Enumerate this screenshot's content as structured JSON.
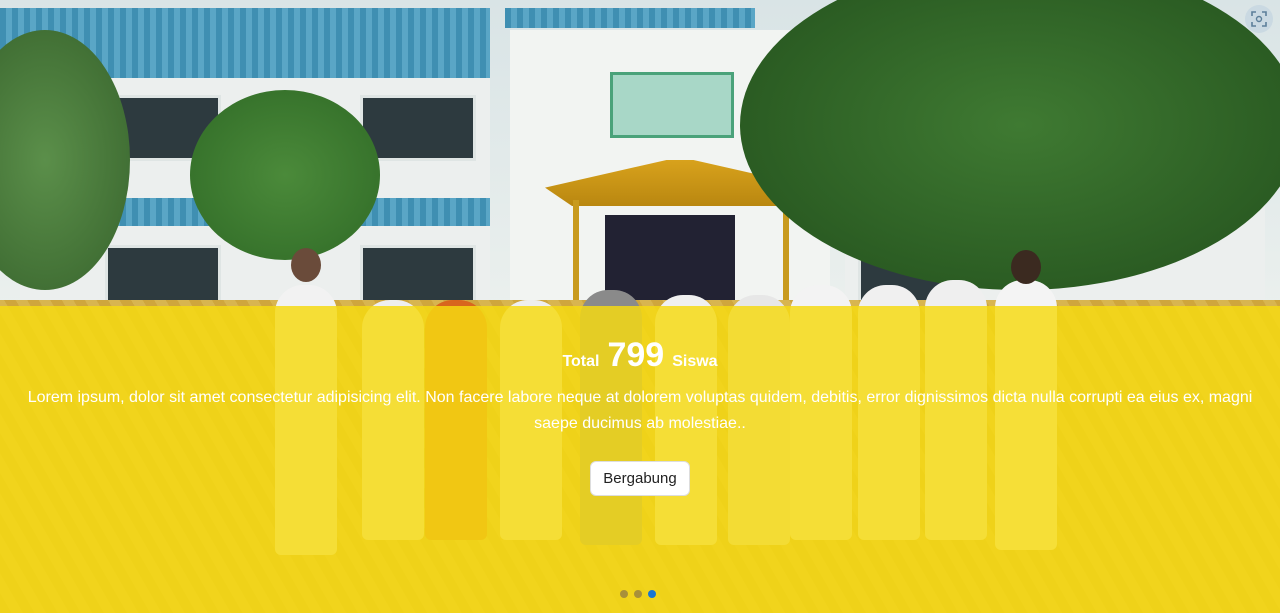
{
  "hero": {
    "total_prefix": "Total",
    "total_count": "799",
    "total_suffix": "Siswa",
    "description": "Lorem ipsum, dolor sit amet consectetur adipisicing elit. Non facere labore neque at dolorem voluptas quidem, debitis, error dignissimos dicta nulla corrupti ea eius ex, magni saepe ducimus ab molestiae..",
    "cta_label": "Bergabung",
    "overlay_color": "#f6da12"
  },
  "carousel": {
    "slides": 3,
    "active_index": 2,
    "active_color": "#1976d2"
  },
  "icons": {
    "corner": "screen-capture-icon"
  }
}
